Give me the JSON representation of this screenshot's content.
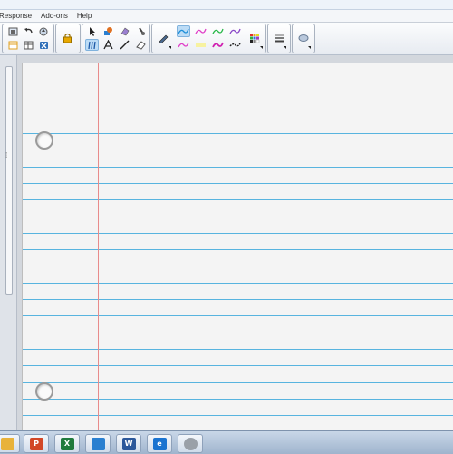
{
  "menubar": {
    "items": [
      "Response",
      "Add-ons",
      "Help"
    ]
  },
  "toolbar": {
    "colors": {
      "pen_blue": "#1e8fd8",
      "pen_pink": "#e040c8",
      "pen_green": "#2ab84a",
      "pen_purple": "#8a48c8",
      "active_bg": "#bcdcf6",
      "lock": "#e8a800"
    }
  },
  "notebook": {
    "rule_color": "#58b4df",
    "margin_color": "#e88b8b",
    "paper_color": "#f4f4f4"
  },
  "taskbar": {
    "apps": [
      {
        "icon": "folder-icon",
        "label": "",
        "color": "#e8b23a"
      },
      {
        "icon": "powerpoint-icon",
        "label": "P",
        "color": "#d24726"
      },
      {
        "icon": "excel-icon",
        "label": "X",
        "color": "#1f7a3c"
      },
      {
        "icon": "notebook-app-icon",
        "label": "",
        "color": "#2a7fd0"
      },
      {
        "icon": "word-icon",
        "label": "W",
        "color": "#2b579a"
      },
      {
        "icon": "internet-explorer-icon",
        "label": "e",
        "color": "#1a73d0"
      },
      {
        "icon": "media-player-icon",
        "label": "",
        "color": "#9aa0a8"
      }
    ]
  }
}
